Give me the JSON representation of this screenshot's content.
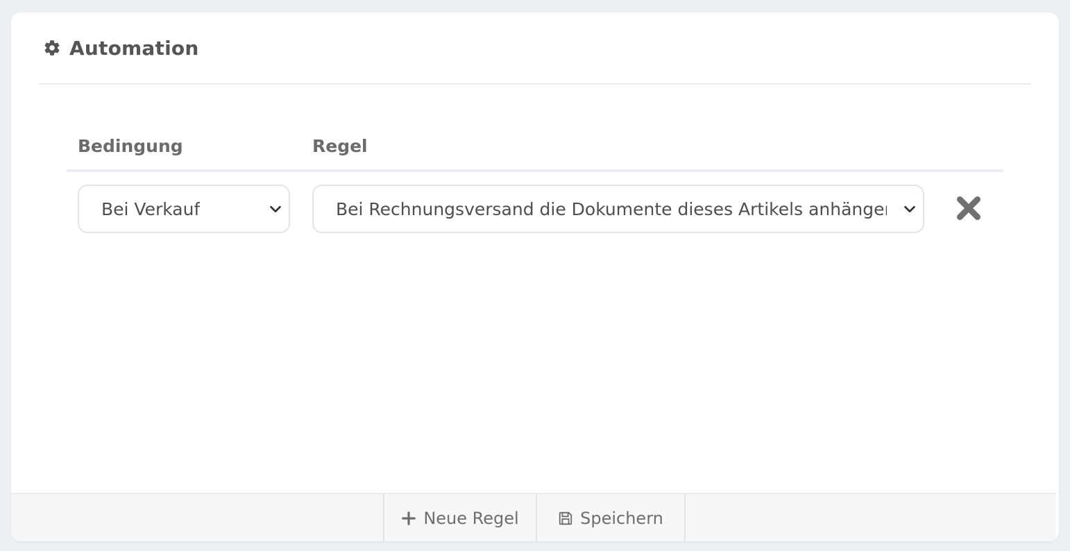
{
  "panel": {
    "title": "Automation",
    "icon": "gear-icon"
  },
  "table": {
    "headers": {
      "condition": "Bedingung",
      "rule": "Regel"
    },
    "rows": [
      {
        "condition": "Bei Verkauf",
        "rule": "Bei Rechnungsversand die Dokumente dieses Artikels anhängen",
        "remove_icon": "close-icon"
      }
    ]
  },
  "footer": {
    "new_rule_label": "Neue Regel",
    "new_rule_icon": "plus-icon",
    "save_label": "Speichern",
    "save_icon": "floppy-disk-icon"
  },
  "colors": {
    "background": "#edf0f3",
    "card": "#ffffff",
    "title": "#555555",
    "footer": "#f7f7f7"
  }
}
